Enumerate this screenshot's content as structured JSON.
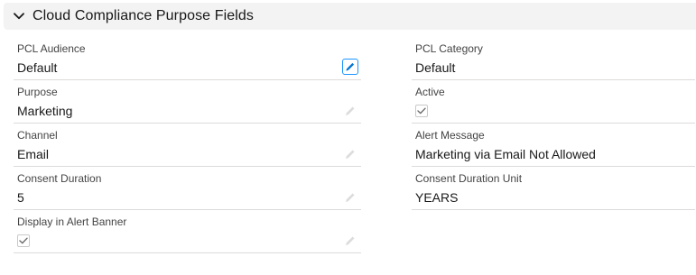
{
  "section": {
    "title": "Cloud Compliance Purpose Fields",
    "icon": "chevron-down-icon"
  },
  "left_fields": [
    {
      "label": "PCL Audience",
      "value": "Default"
    },
    {
      "label": "Purpose",
      "value": "Marketing"
    },
    {
      "label": "Channel",
      "value": "Email"
    },
    {
      "label": "Consent Duration",
      "value": "5"
    },
    {
      "label": "Display in Alert Banner",
      "checked": true
    }
  ],
  "right_fields": [
    {
      "label": "PCL Category",
      "value": "Default"
    },
    {
      "label": "Active",
      "checked": true
    },
    {
      "label": "Alert Message",
      "value": "Marketing via Email Not Allowed"
    },
    {
      "label": "Consent Duration Unit",
      "value": "YEARS"
    }
  ],
  "colors": {
    "header_bg": "#f3f3f3",
    "divider": "#dddbda",
    "edit_icon_active": "#0176d3",
    "edit_icon_inactive": "#c9c9c9"
  }
}
